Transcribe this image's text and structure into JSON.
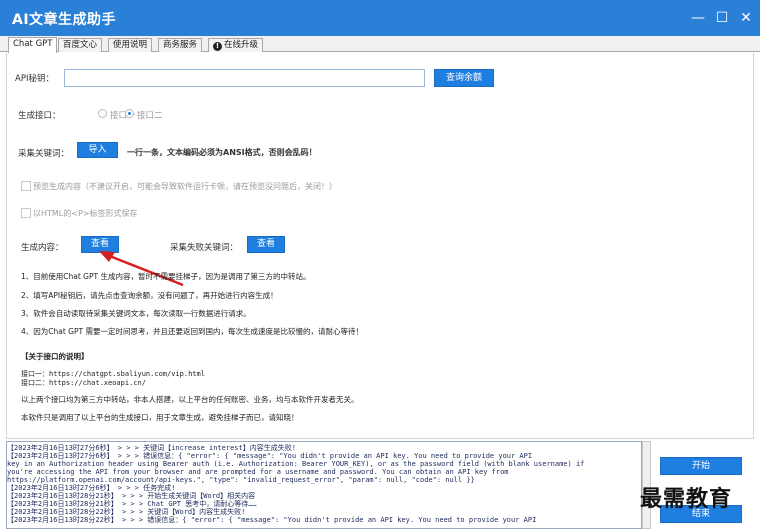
{
  "window": {
    "title": "AI文章生成助手",
    "minimize": "—",
    "maximize": "☐",
    "close": "✕"
  },
  "tabs": [
    {
      "label": "Chat GPT",
      "active": true
    },
    {
      "label": "百度文心",
      "active": false
    },
    {
      "label": "使用说明",
      "active": false
    },
    {
      "label": "商务服务",
      "active": false
    },
    {
      "label": "在线升级",
      "active": false
    }
  ],
  "form": {
    "api_key_label": "API秘钥：",
    "api_key_value": "",
    "query_balance_button": "查询余额",
    "interface_label": "生成接口：",
    "interface_options": [
      {
        "label": "接口一",
        "checked": false
      },
      {
        "label": "接口二",
        "checked": true
      }
    ],
    "keywords_label": "采集关键词：",
    "import_button": "导入",
    "keywords_hint": "一行一条，文本编码必须为ANSI格式，否则会乱码！",
    "preview_checkbox": "预览生成内容（不建议开启，可能会导致软件运行卡顿，请在预览没问题后，关闭！）",
    "html_p_checkbox": "以HTML的<P>标签形式保存",
    "generated_label": "生成内容：",
    "view_button": "查看",
    "failed_keywords_label": "采集失败关键词：",
    "view_failed_button": "查看"
  },
  "notes": [
    "1、目前使用Chat GPT 生成内容，暂时不需要挂梯子，因为是调用了第三方的中转站。",
    "2、填写API秘钥后，请先点击查询余额，没有问题了，再开始进行内容生成！",
    "3、软件会自动读取待采集关键词文本，每次读取一行数据进行请求。",
    "4、因为Chat GPT 需要一定时间思考，并且还要返回到国内，每次生成速度是比较慢的，请耐心等待！"
  ],
  "interface_section": {
    "heading": "【关于接口的说明】",
    "lines": [
      "接口一：https://chatgpt.sbaliyun.com/vip.html",
      "接口二：https://chat.xeoapi.cn/"
    ],
    "disclaimer_1": "以上两个接口均为第三方中转站，非本人搭建，以上平台的任何账密、业务，均与本软件开发者无关。",
    "disclaimer_2": "本软件只是调用了以上平台的生成接口，用于文章生成，避免挂梯子而已，请知晓！"
  },
  "log": [
    "【2023年2月16日13时27分6秒】 > > >  关键词【increase interest】内容生成失败!",
    "【2023年2月16日13时27分6秒】 > > >  错误信息：{      \"error\":  {      \"message\": \"You didn't provide an API key. You need to provide your API",
    "key in an Authorization header using Bearer auth (i.e. Authorization: Bearer YOUR_KEY), or as the password field (with blank username) if",
    "you're accessing the API from your browser and are prompted for a username and password. You can obtain an API key from",
    "https://platform.openai.com/account/api-keys.\",      \"type\": \"invalid_request_error\",      \"param\": null,      \"code\": null    }}",
    "【2023年2月16日13时27分6秒】 > > >  任务完成!",
    "【2023年2月16日13时28分21秒】 > > >  开始生成关键词【Word】相关内容",
    "【2023年2月16日13时28分21秒】 > > >  Chat GPT 思考中，请耐心等待……",
    "【2023年2月16日13时28分22秒】 > > >  关键词【Word】内容生成失败!",
    "【2023年2月16日13时28分22秒】 > > >  错误信息：{      \"error\":  {      \"message\": \"You didn't provide an API key. You need to provide your API"
  ],
  "actions": {
    "start_button": "开始",
    "stop_button": "结束"
  },
  "watermark": "最需教育"
}
